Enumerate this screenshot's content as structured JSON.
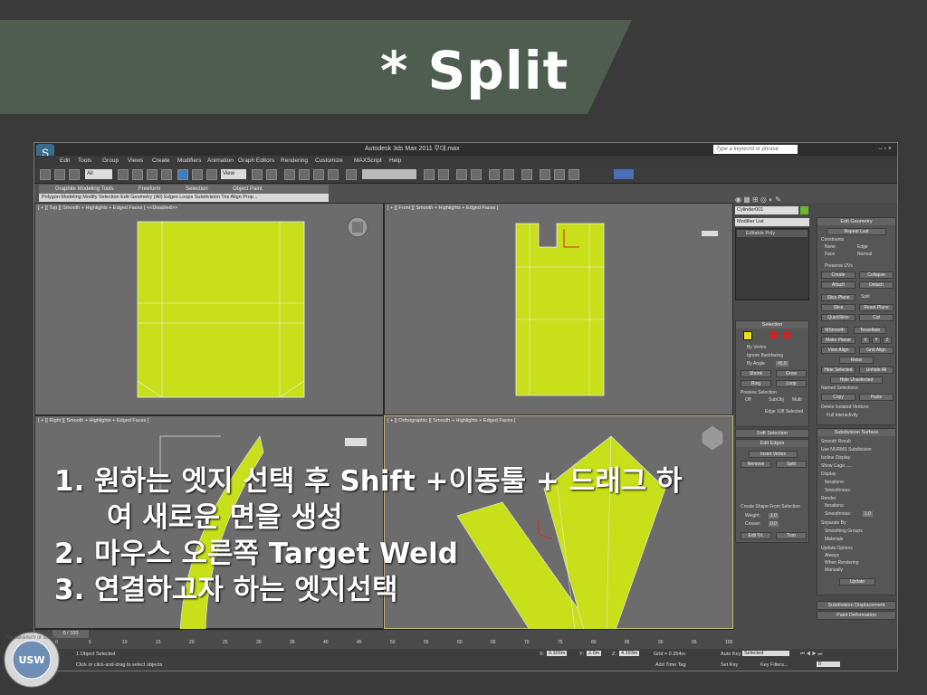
{
  "slide": {
    "title": "* Split",
    "instructions": [
      {
        "num": "1.",
        "text": "원하는 엣지 선택 후 Shift +이동툴 + 드래그 하",
        "cont": "여 새로운 면을 생성"
      },
      {
        "num": "2.",
        "text": "마우스 오른쪽 Target Weld"
      },
      {
        "num": "3.",
        "text": "연결하고자 하는 엣지선택"
      }
    ],
    "seal_text": "USW",
    "seal_ring": "THE UNIVERSITY OF SUWON"
  },
  "app": {
    "title": "Autodesk 3ds Max 2011    무대.max",
    "search_placeholder": "Type a keyword or phrase",
    "menu": [
      "Edit",
      "Tools",
      "Group",
      "Views",
      "Create",
      "Modifiers",
      "Animation",
      "Graph Editors",
      "Rendering",
      "Customize",
      "MAXScript",
      "Help"
    ],
    "toolbar_dropdown_all": "All",
    "toolbar_dropdown_view": "View",
    "ribbon_tabs": [
      "Graphite Modeling Tools",
      "Freeform",
      "Selection",
      "Object Paint"
    ],
    "ribbon_subtabs": "Polygon Modeling  Modify Selection  Edit  Geometry (All)  Edges  Loops  Subdivision  Tris  Align  Prop...",
    "viewports": {
      "top": "[ + ][ Top ][ Smooth + Highlights + Edged Faces ]  <<Disabled>>",
      "front": "[ + ][ Front ][ Smooth + Highlights + Edged Faces ]",
      "right": "[ + ][ Right ][ Smooth + Highlights + Edged Faces ]",
      "ortho": "[ + ][ Orthographic ][ Smooth + Highlights + Edged Faces ]"
    },
    "cmd": {
      "object_name": "Cylinder001",
      "modifier_list": "Modifier List",
      "stack_item": "Editable Poly",
      "selection": {
        "title": "Selection",
        "by_vertex": "By Vertex",
        "ignore_backfacing": "Ignore Backfacing",
        "by_angle": "By Angle",
        "angle_value": "45.0",
        "shrink": "Shrink",
        "grow": "Grow",
        "ring": "Ring",
        "loop": "Loop",
        "preview": "Preview Selection",
        "off": "Off",
        "subobj": "SubObj",
        "multi": "Multi",
        "status": "Edge 108 Selected"
      },
      "soft_selection": "Soft Selection",
      "edit_edges": {
        "title": "Edit Edges",
        "insert_vertex": "Insert Vertex",
        "remove": "Remove",
        "split": "Split",
        "create_shape": "Create Shape From Selection",
        "weight": "Weight:",
        "weight_val": "1.0",
        "crease": "Crease:",
        "crease_val": "0.0",
        "edit_tri": "Edit Tri.",
        "turn": "Turn"
      },
      "edit_geometry": {
        "title": "Edit Geometry",
        "repeat_last": "Repeat Last",
        "constraints": "Constraints",
        "none": "None",
        "edge": "Edge",
        "face": "Face",
        "normal": "Normal",
        "preserve_uvs": "Preserve UVs",
        "create": "Create",
        "collapse": "Collapse",
        "attach": "Attach",
        "detach": "Detach",
        "slice_plane": "Slice Plane",
        "split": "Split",
        "slice": "Slice",
        "reset_plane": "Reset Plane",
        "quickslice": "QuickSlice",
        "cut": "Cut",
        "msmooth": "MSmooth",
        "tessellate": "Tessellate",
        "make_planar": "Make Planar",
        "x": "X",
        "y": "Y",
        "z": "Z",
        "view_align": "View Align",
        "grid_align": "Grid Align",
        "relax": "Relax",
        "hide_selected": "Hide Selected",
        "unhide_all": "Unhide All",
        "hide_unselected": "Hide Unselected",
        "named_selections": "Named Selections:",
        "copy": "Copy",
        "paste": "Paste",
        "delete_isolated": "Delete Isolated Vertices",
        "full_interactivity": "Full Interactivity"
      },
      "subdivision_surface": {
        "title": "Subdivision Surface",
        "smooth_result": "Smooth Result",
        "use_nurms": "Use NURMS Subdivision",
        "isoline": "Isoline Display",
        "show_cage": "Show Cage......",
        "display": "Display",
        "iterations": "Iterations:",
        "smoothness": "Smoothness:",
        "render": "Render",
        "r_iterations": "Iterations:",
        "r_smoothness": "Smoothness:",
        "r_smooth_val": "1.0",
        "separate_by": "Separate By",
        "smoothing_groups": "Smoothing Groups",
        "materials": "Materials",
        "update_options": "Update Options",
        "always": "Always",
        "when_rendering": "When Rendering",
        "manually": "Manually",
        "update": "Update"
      },
      "subdivision_displacement": "Subdivision Displacement",
      "paint_deformation": "Paint Deformation"
    },
    "timeline": {
      "frame": "0 / 100",
      "ticks": [
        "0",
        "5",
        "10",
        "15",
        "20",
        "25",
        "30",
        "35",
        "40",
        "45",
        "50",
        "55",
        "60",
        "65",
        "70",
        "75",
        "80",
        "85",
        "90",
        "95",
        "100"
      ]
    },
    "status": {
      "selected": "1 Object Selected",
      "prompt": "Click or click-and-drag to select objects",
      "x_label": "X:",
      "x": "0.326m",
      "y_label": "Y:",
      "y": "2.0m",
      "z_label": "Z:",
      "z": "4.193m",
      "grid": "Grid = 0.254m",
      "auto_key": "Auto Key",
      "selected_dd": "Selected",
      "set_key": "Set Key",
      "key_filters": "Key Filters...",
      "add_time_tag": "Add Time Tag",
      "frame_val": "0"
    }
  }
}
